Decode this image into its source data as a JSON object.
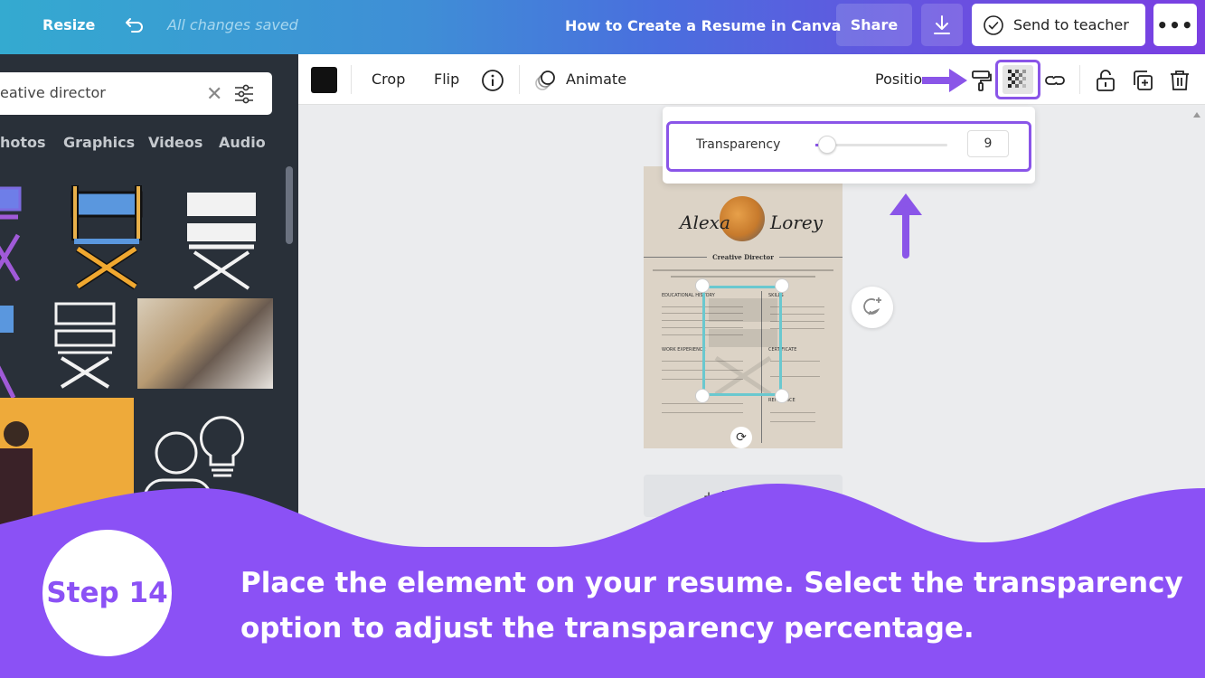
{
  "topbar": {
    "resize_label": "Resize",
    "undo_icon": "undo-icon",
    "save_status": "All changes saved",
    "document_title": "How to Create a Resume in Canva",
    "share_label": "Share",
    "download_icon": "download-icon",
    "send_label": "Send to teacher",
    "more_label": "•••"
  },
  "sidebar": {
    "search": {
      "value": "eative director",
      "clear_icon": "close-icon",
      "filter_icon": "filter-icon"
    },
    "tabs": [
      {
        "label": "hotos"
      },
      {
        "label": "Graphics"
      },
      {
        "label": "Videos"
      },
      {
        "label": "Audio"
      }
    ],
    "collapse_icon": "‹"
  },
  "toolbar": {
    "crop_label": "Crop",
    "flip_label": "Flip",
    "animate_label": "Animate",
    "position_label": "Positio"
  },
  "transparency": {
    "label": "Transparency",
    "value": "9",
    "percent": 9
  },
  "resume": {
    "first_name": "Alexa",
    "last_name": "Lorey",
    "role": "Creative Director",
    "sections": [
      "EDUCATIONAL HISTORY",
      "SKILLS",
      "WORK EXPERIENCE",
      "CERTIFICATE",
      "REFERENCE"
    ]
  },
  "canvas": {
    "add_page_label": "+ Add page"
  },
  "overlay": {
    "step_label": "Step 14",
    "instruction": "Place the element on your resume. Select the transparency option to adjust the transparency percentage.",
    "accent": "#8b51f5"
  }
}
